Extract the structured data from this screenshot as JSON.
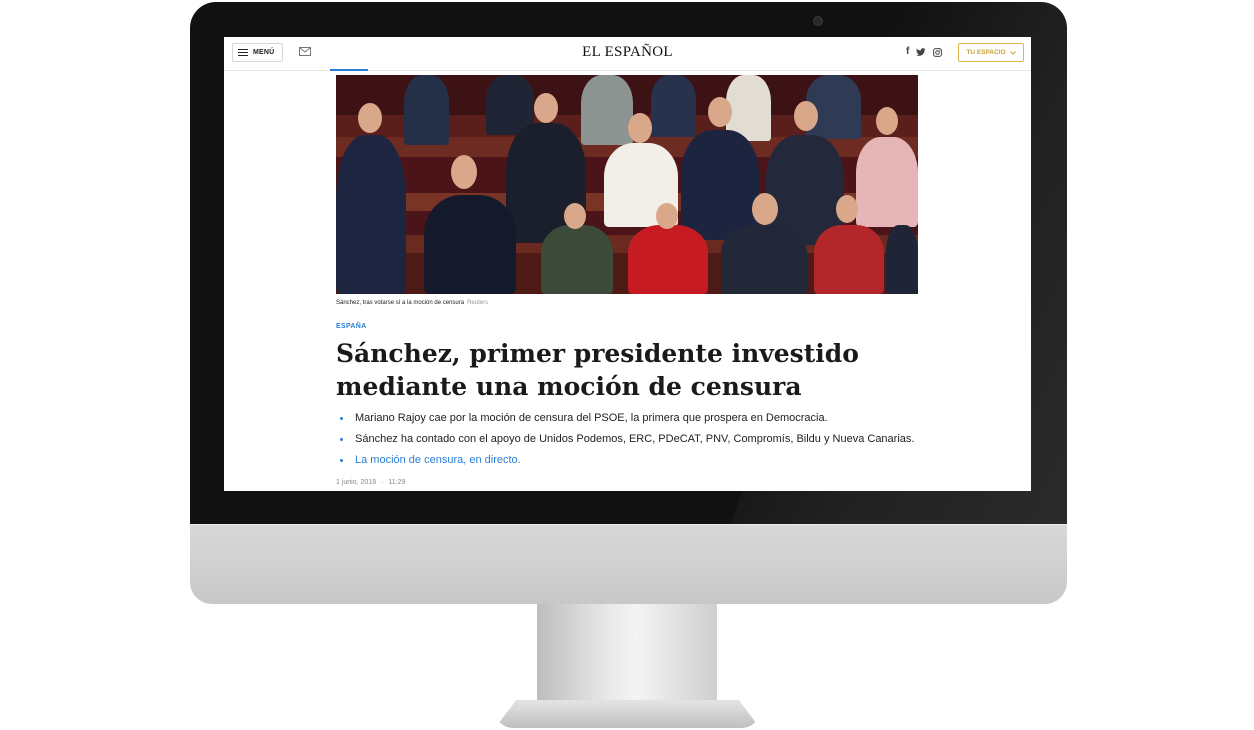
{
  "site": {
    "logo": "EL ESPAÑOL",
    "menu_label": "MENÚ",
    "account_button": "TU ESPACIO",
    "icons": [
      "menu-icon",
      "mail-icon",
      "facebook-icon",
      "twitter-icon",
      "instagram-icon",
      "chevron-down-icon"
    ],
    "social": {
      "facebook": "f",
      "twitter": "🐦",
      "instagram": "◎"
    }
  },
  "article": {
    "photo_caption": "Sánchez, tras votarse sí a la moción de censura",
    "photo_credit": "Reuters",
    "section": "ESPAÑA",
    "headline": "Sánchez, primer presidente investido mediante una moción de censura",
    "bullets": [
      "Mariano Rajoy cae por la moción de censura del PSOE, la primera que prospera en Democracia.",
      "Sánchez ha contado con el apoyo de Unidos Podemos, ERC, PDeCAT, PNV, Compromís, Bildu y Nueva Canarias.",
      "La moción de censura, en directo."
    ],
    "date": "1 junio, 2018",
    "time": "11:29",
    "date_separator": "·"
  },
  "colors": {
    "accent_blue": "#2a7fd4",
    "gold": "#c8a035",
    "monitor_bezel": "#111111"
  }
}
